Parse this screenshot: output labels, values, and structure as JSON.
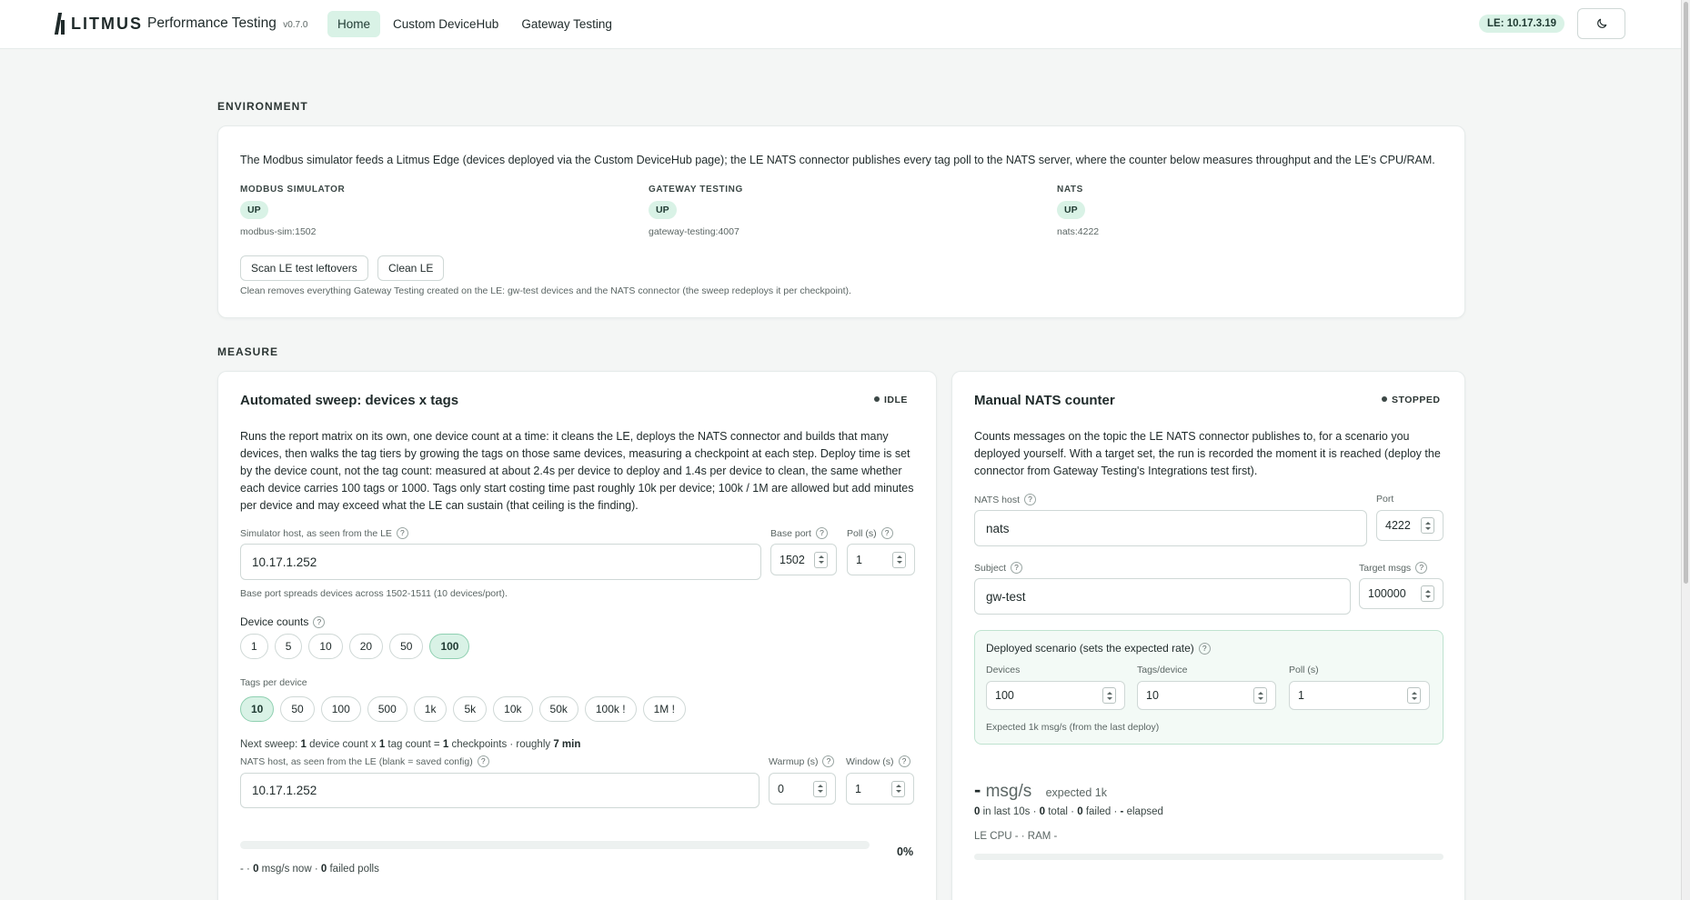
{
  "header": {
    "logo_text": "LITMUS",
    "app_title": "Performance Testing",
    "version": "v0.7.0",
    "nav": [
      "Home",
      "Custom DeviceHub",
      "Gateway Testing"
    ],
    "active_nav": "Home",
    "le_badge": "LE: 10.17.3.19",
    "theme_icon": "moon-icon"
  },
  "environment": {
    "section_label": "ENVIRONMENT",
    "description": "The Modbus simulator feeds a Litmus Edge (devices deployed via the Custom DeviceHub page); the LE NATS connector publishes every tag poll to the NATS server, where the counter below measures throughput and the LE's CPU/RAM.",
    "services": [
      {
        "label": "MODBUS SIMULATOR",
        "status": "UP",
        "address": "modbus-sim:1502"
      },
      {
        "label": "GATEWAY TESTING",
        "status": "UP",
        "address": "gateway-testing:4007"
      },
      {
        "label": "NATS",
        "status": "UP",
        "address": "nats:4222"
      }
    ],
    "scan_button": "Scan LE test leftovers",
    "clean_button": "Clean LE",
    "note": "Clean removes everything Gateway Testing created on the LE: gw-test devices and the NATS connector (the sweep redeploys it per checkpoint)."
  },
  "measure": {
    "section_label": "MEASURE",
    "sweep": {
      "title": "Automated sweep: devices x tags",
      "status": "IDLE",
      "description_lines": [
        "Runs the report matrix on its own, one device count at a time: it cleans the LE, deploys the NATS connector and builds that many",
        "devices, then walks the tag tiers by growing the tags on those same devices, measuring a checkpoint at each step. Deploy time is set",
        "by the device count, not the tag count: measured at about 2.4s per device to deploy and 1.4s per device to clean, the same whether",
        "each device carries 100 tags or 1000. Tags only start costing time past roughly 10k per device; 100k / 1M are allowed but add minutes",
        "per device and may exceed what the LE can sustain (that ceiling is the finding)."
      ],
      "sim_host_label": "Simulator host, as seen from the LE",
      "sim_host_value": "10.17.1.252",
      "base_port_label": "Base port",
      "base_port_value": "1502",
      "poll_label": "Poll (s)",
      "poll_value": "1",
      "base_port_note": "Base port spreads devices across 1502-1511 (10 devices/port).",
      "device_counts_label": "Device counts",
      "device_counts": [
        "1",
        "5",
        "10",
        "20",
        "50",
        "100"
      ],
      "device_counts_selected": "100",
      "tags_label": "Tags per device",
      "tags": [
        "10",
        "50",
        "100",
        "500",
        "1k",
        "5k",
        "10k",
        "50k",
        "100k !",
        "1M !"
      ],
      "tags_selected": "10",
      "next_sweep": {
        "prefix": "Next sweep:",
        "device_count": "1",
        "mid1": "device count x",
        "tag_count": "1",
        "mid2": "tag count =",
        "checkpoints": "1",
        "mid3": "checkpoints · roughly",
        "duration": "7 min"
      },
      "nats_host_label": "NATS host, as seen from the LE (blank = saved config)",
      "nats_host_value": "10.17.1.252",
      "warmup_label": "Warmup (s)",
      "warmup_value": "0",
      "window_label": "Window (s)",
      "window_value": "1",
      "progress": 0,
      "progress_text": "0%",
      "footer": {
        "dash": "- ·",
        "rate": "0",
        "rate_unit": "msg/s now ·",
        "failed": "0",
        "failed_unit": "failed polls"
      }
    },
    "manual": {
      "title": "Manual NATS counter",
      "status": "STOPPED",
      "description_lines": [
        "Counts messages on the topic the LE NATS connector publishes to, for a scenario you",
        "deployed yourself. With a target set, the run is recorded the moment it is reached (deploy the",
        "connector from Gateway Testing's Integrations test first)."
      ],
      "nats_host_label": "NATS host",
      "nats_host_value": "nats",
      "port_label": "Port",
      "port_value": "4222",
      "subject_label": "Subject",
      "subject_value": "gw-test",
      "target_label": "Target msgs",
      "target_value": "100000",
      "scenario": {
        "title": "Deployed scenario (sets the expected rate)",
        "devices_label": "Devices",
        "devices_value": "100",
        "tags_label": "Tags/device",
        "tags_value": "10",
        "poll_label": "Poll (s)",
        "poll_value": "1",
        "expected_note": "Expected 1k msg/s (from the last deploy)"
      },
      "rate_value": "-",
      "rate_unit": "msg/s",
      "rate_expected": "expected 1k",
      "stats": {
        "last10": "0",
        "last10_unit": "in last 10s ·",
        "total": "0",
        "total_unit": "total ·",
        "failed": "0",
        "failed_unit": "failed ·",
        "elapsed": "-",
        "elapsed_unit": "elapsed"
      },
      "resources": "LE CPU - · RAM -"
    }
  },
  "colors": {
    "accent_bg": "#d9f2e6",
    "accent_border": "#8fd0b1",
    "text": "#1f2a2a",
    "muted": "#5b6664",
    "page_bg": "#f4f6f5"
  }
}
